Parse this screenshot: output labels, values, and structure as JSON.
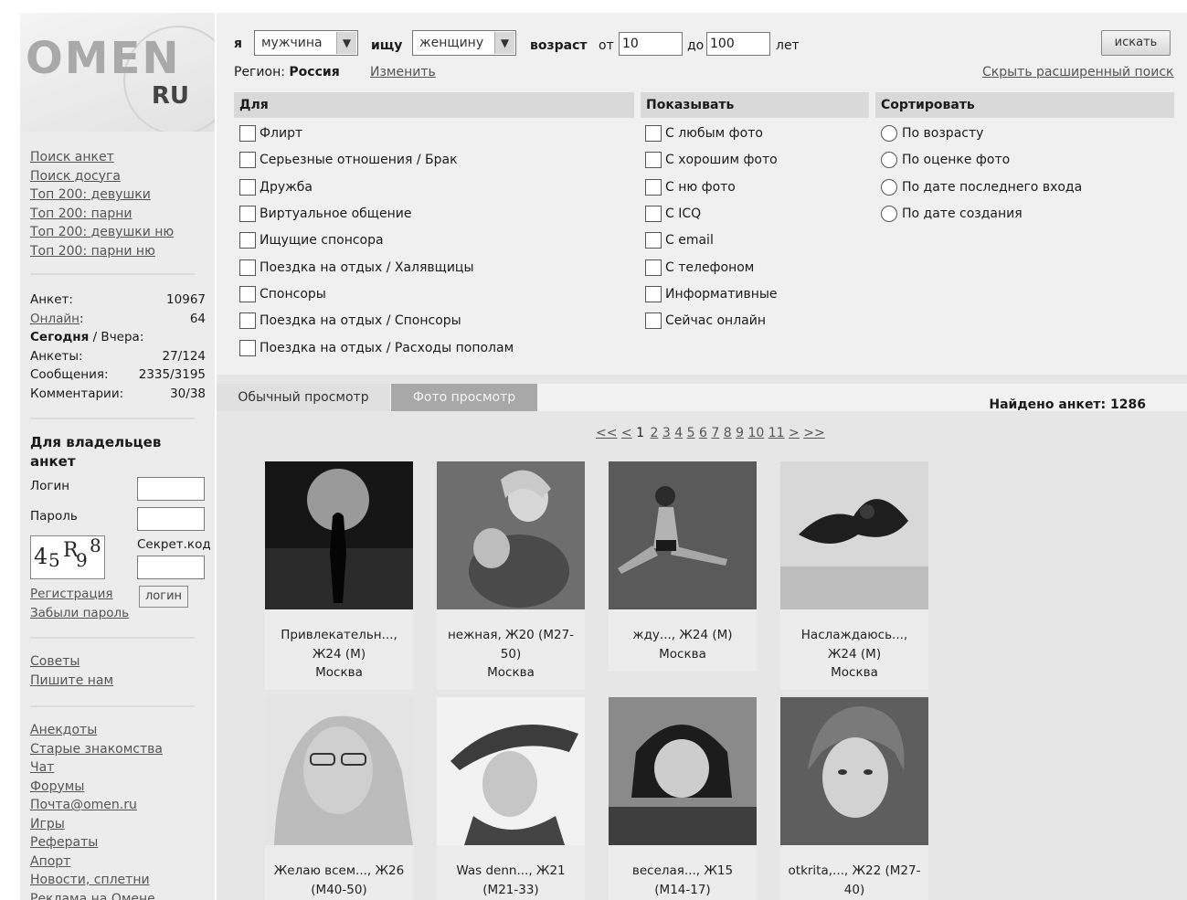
{
  "logo": {
    "mark": "OMEN",
    "ru": "RU"
  },
  "sidebar": {
    "nav": [
      "Поиск анкет",
      "Поиск досуга",
      "Топ 200: девушки",
      "Топ 200: парни",
      "Топ 200: девушки ню",
      "Топ 200: парни ню"
    ],
    "stats": {
      "profiles_label": "Анкет:",
      "profiles_value": "10967",
      "online_label": "Онлайн",
      "online_colon": ":",
      "online_value": "64",
      "today_bold": "Сегодня",
      "today_rest": " / Вчера:",
      "ankets_label": "Анкеты:",
      "ankets_value": "27/124",
      "messages_label": "Сообщения:",
      "messages_value": "2335/3195",
      "comments_label": "Комментарии:",
      "comments_value": "30/38"
    },
    "login": {
      "title": "Для владельцев анкет",
      "login_label": "Логин",
      "password_label": "Пароль",
      "secret_label": "Секрет.код",
      "captcha": [
        "4",
        "5",
        "R",
        "9",
        "8"
      ],
      "login_button": "логин",
      "register_link": "Регистрация",
      "forgot_link": "Забыли пароль"
    },
    "help": [
      "Советы",
      "Пишите нам"
    ],
    "more": [
      "Анекдоты",
      "Старые знакомства",
      "Чат",
      "Форумы",
      "Почта@omen.ru",
      "Игры",
      "Рефераты",
      "Апорт",
      "Новости, сплетни",
      "Реклама на Омене"
    ]
  },
  "search": {
    "i_label": "я",
    "gender_value": "мужчина",
    "seek_label": "ищу",
    "seek_value": "женщину",
    "age_label": "возраст",
    "from_label": "от",
    "age_from": "10",
    "to_label": "до",
    "age_to": "100",
    "years_label": "лет",
    "button": "искать",
    "region_label": "Регион:",
    "region_value": "Россия",
    "change_link": "Изменить",
    "hide_link": "Скрыть расширенный поиск",
    "col_for": "Для",
    "col_show": "Показывать",
    "col_sort": "Сортировать",
    "for_options": [
      "Флирт",
      "Серьезные отношения / Брак",
      "Дружба",
      "Виртуальное общение",
      "Ищущие спонсора",
      "Поездка на отдых / Халявщицы",
      "Спонсоры",
      "Поездка на отдых / Спонсоры",
      "Поездка на отдых / Расходы пополам"
    ],
    "show_options": [
      "С любым фото",
      "С хорошим фото",
      "С ню фото",
      "С ICQ",
      "С email",
      "С телефоном",
      "Информативные",
      "Сейчас онлайн"
    ],
    "sort_options": [
      "По возрасту",
      "По оценке фото",
      "По дате последнего входа",
      "По дате создания"
    ]
  },
  "results": {
    "tab_normal": "Обычный просмотр",
    "tab_photo": "Фото просмотр",
    "found_label": "Найдено анкет:",
    "found_count": "1286",
    "pager": {
      "first": "<<",
      "prev": "<",
      "pages": [
        "1",
        "2",
        "3",
        "4",
        "5",
        "6",
        "7",
        "8",
        "9",
        "10",
        "11"
      ],
      "next": ">",
      "last": ">>"
    },
    "cards": [
      {
        "line1": "Привлекательн...,",
        "line2": "Ж24 (М)",
        "city": "Москва"
      },
      {
        "line1": "нежная, Ж20 (М27-",
        "line2": "50)",
        "city": "Москва"
      },
      {
        "line1": "жду..., Ж24 (М)",
        "line2": "Москва",
        "city": ""
      },
      {
        "line1": "Наслаждаюсь...,",
        "line2": "Ж24 (М)",
        "city": "Москва"
      },
      {
        "line1": "Желаю всем..., Ж26",
        "line2": "(М40-50)",
        "city": ""
      },
      {
        "line1": "Was denn..., Ж21",
        "line2": "(М21-33)",
        "city": ""
      },
      {
        "line1": "веселая..., Ж15",
        "line2": "(М14-17)",
        "city": ""
      },
      {
        "line1": "otkrita,..., Ж22 (М27-",
        "line2": "40)",
        "city": ""
      }
    ]
  }
}
